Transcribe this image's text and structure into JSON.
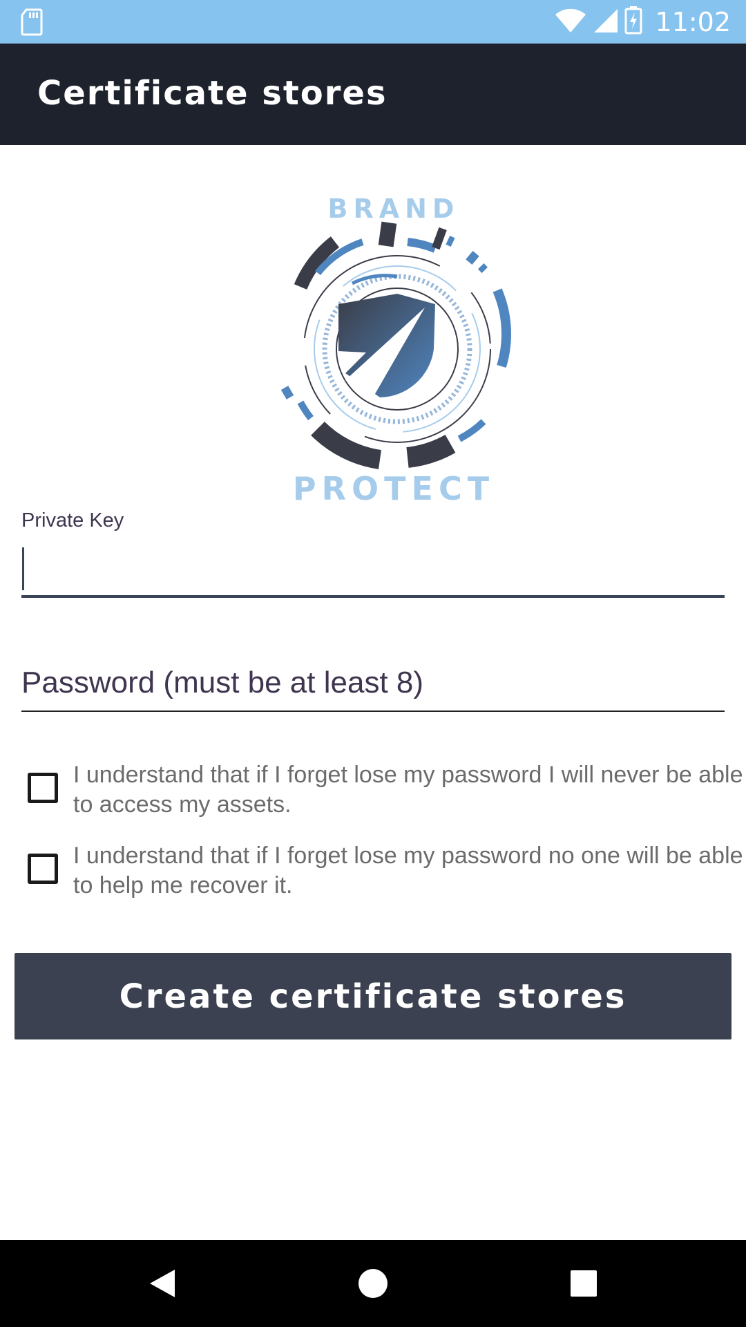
{
  "status_bar": {
    "time": "11:02",
    "icons": [
      "sd-card-icon",
      "wifi-icon",
      "signal-icon",
      "battery-charging-icon"
    ]
  },
  "toolbar": {
    "title": "Certificate stores"
  },
  "logo": {
    "top_text": "BRAND",
    "bottom_text": "PROTECT",
    "colors": {
      "light_blue": "#a6ccec",
      "mid_blue": "#4a7fb5",
      "dark": "#3a3d48"
    }
  },
  "form": {
    "private_key": {
      "label": "Private Key",
      "value": ""
    },
    "password": {
      "placeholder": "Password (must be at least 8)",
      "value": ""
    },
    "checkboxes": [
      {
        "label": "I understand that if I forget lose my password I will never be able to access my assets.",
        "checked": false
      },
      {
        "label": "I understand that if I forget lose my password no one will be able to help me recover it.",
        "checked": false
      }
    ],
    "submit_label": "Create certificate stores"
  },
  "nav_bar": {
    "buttons": [
      "back-icon",
      "home-icon",
      "recents-icon"
    ]
  },
  "colors": {
    "status_bar": "#87c3ef",
    "toolbar": "#1d222c",
    "button": "#3b4150",
    "text_label": "#3f3550",
    "checkbox_text": "#6b6b6b"
  }
}
